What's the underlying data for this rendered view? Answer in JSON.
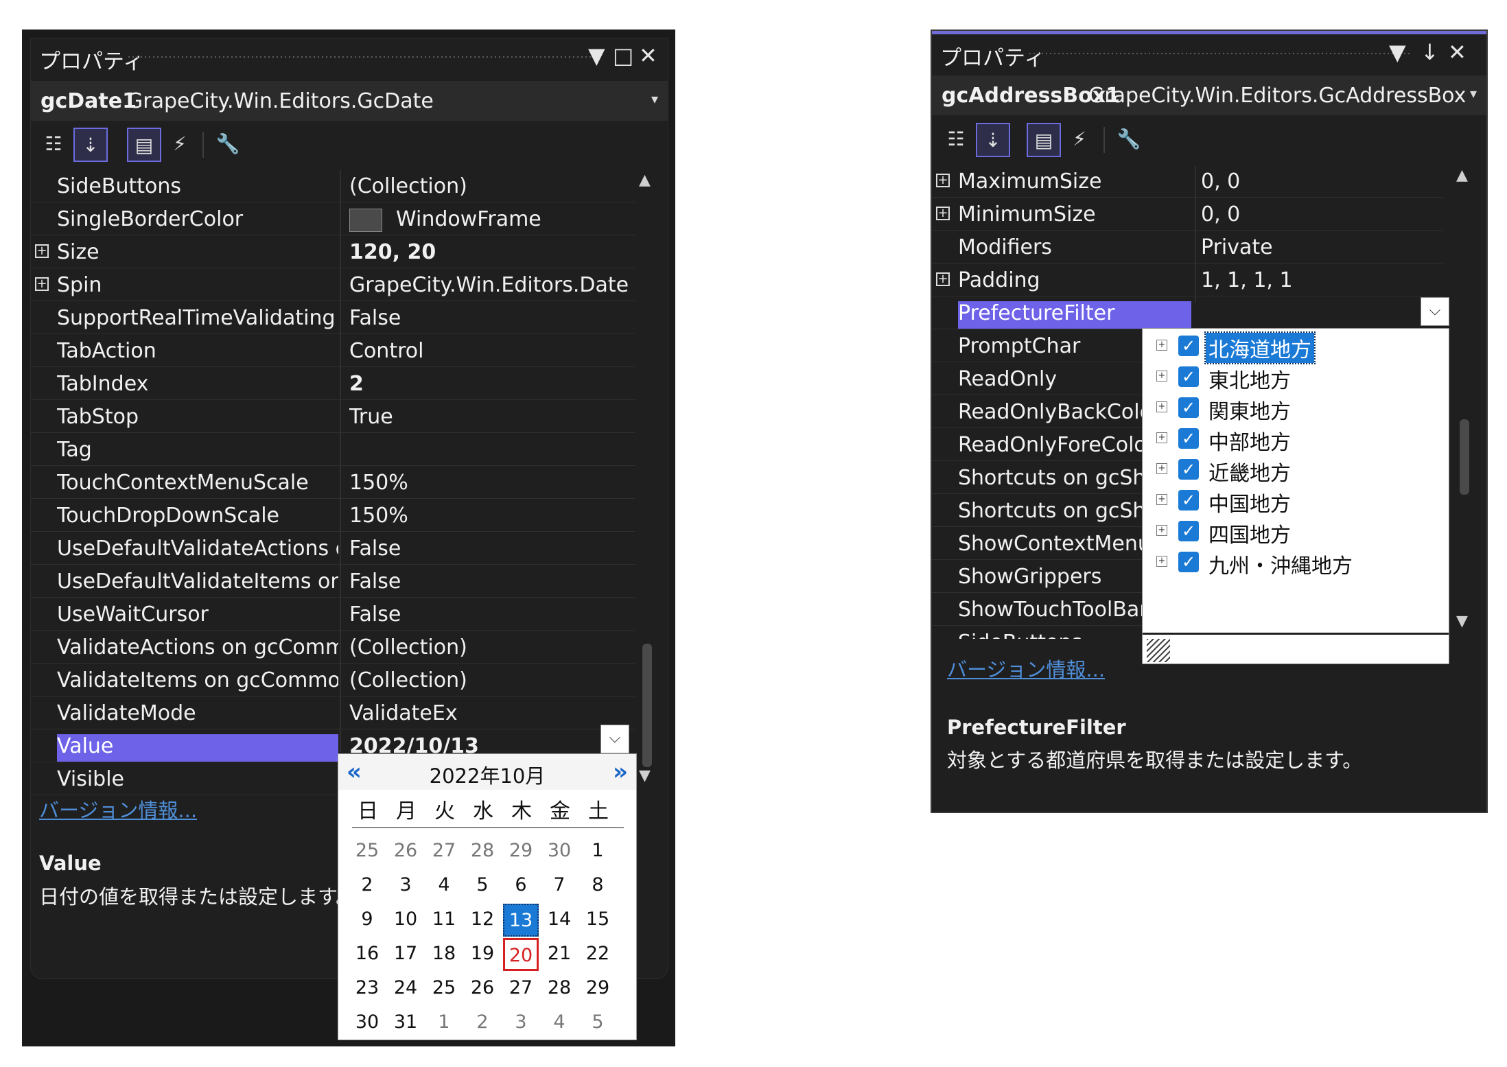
{
  "panel1": {
    "title": "プロパティ",
    "controls": [
      "▼",
      "□",
      "✕"
    ],
    "object_name": "gcDate1",
    "object_class": "GrapeCity.Win.Editors.GcDate",
    "rows": [
      {
        "name": "SideButtons",
        "value": "(Collection)",
        "expand": false,
        "bold": false
      },
      {
        "name": "SingleBorderColor",
        "value": "WindowFrame",
        "expand": false,
        "bold": false,
        "swatch": "#4a4a4a"
      },
      {
        "name": "Size",
        "value": "120, 20",
        "expand": true,
        "bold": true
      },
      {
        "name": "Spin",
        "value": "GrapeCity.Win.Editors.DateSpin",
        "expand": true,
        "bold": false
      },
      {
        "name": "SupportRealTimeValidating on",
        "value": "False",
        "expand": false,
        "bold": false
      },
      {
        "name": "TabAction",
        "value": "Control",
        "expand": false,
        "bold": false
      },
      {
        "name": "TabIndex",
        "value": "2",
        "expand": false,
        "bold": true
      },
      {
        "name": "TabStop",
        "value": "True",
        "expand": false,
        "bold": false
      },
      {
        "name": "Tag",
        "value": "",
        "expand": false,
        "bold": false
      },
      {
        "name": "TouchContextMenuScale",
        "value": "150%",
        "expand": false,
        "bold": false
      },
      {
        "name": "TouchDropDownScale",
        "value": "150%",
        "expand": false,
        "bold": false
      },
      {
        "name": "UseDefaultValidateActions on",
        "value": "False",
        "expand": false,
        "bold": false
      },
      {
        "name": "UseDefaultValidateItems on gc",
        "value": "False",
        "expand": false,
        "bold": false
      },
      {
        "name": "UseWaitCursor",
        "value": "False",
        "expand": false,
        "bold": false
      },
      {
        "name": "ValidateActions on gcCommor",
        "value": "(Collection)",
        "expand": false,
        "bold": false
      },
      {
        "name": "ValidateItems on gcCommonV",
        "value": "(Collection)",
        "expand": false,
        "bold": false
      },
      {
        "name": "ValidateMode",
        "value": "ValidateEx",
        "expand": false,
        "bold": false
      },
      {
        "name": "Value",
        "value": "2022/10/13",
        "expand": false,
        "bold": true,
        "selected": true
      },
      {
        "name": "Visible",
        "value": "",
        "expand": false,
        "bold": false
      }
    ],
    "version_link": "バージョン情報...",
    "desc_title": "Value",
    "desc_text": "日付の値を取得または設定します。"
  },
  "calendar": {
    "prev": "«",
    "next": "»",
    "month_label": "2022年10月",
    "weekdays": [
      "日",
      "月",
      "火",
      "水",
      "木",
      "金",
      "土"
    ],
    "weeks": [
      [
        "25",
        "26",
        "27",
        "28",
        "29",
        "30",
        "1"
      ],
      [
        "2",
        "3",
        "4",
        "5",
        "6",
        "7",
        "8"
      ],
      [
        "9",
        "10",
        "11",
        "12",
        "13",
        "14",
        "15"
      ],
      [
        "16",
        "17",
        "18",
        "19",
        "20",
        "21",
        "22"
      ],
      [
        "23",
        "24",
        "25",
        "26",
        "27",
        "28",
        "29"
      ],
      [
        "30",
        "31",
        "1",
        "2",
        "3",
        "4",
        "5"
      ]
    ],
    "selected_day": "13",
    "today_day": "20"
  },
  "panel2": {
    "title": "プロパティ",
    "controls": [
      "▼",
      "↓",
      "✕"
    ],
    "object_name": "gcAddressBox1",
    "object_class": "GrapeCity.Win.Editors.GcAddressBox",
    "rows": [
      {
        "name": "MaximumSize",
        "value": "0, 0",
        "expand": true
      },
      {
        "name": "MinimumSize",
        "value": "0, 0",
        "expand": true
      },
      {
        "name": "Modifiers",
        "value": "Private",
        "expand": false
      },
      {
        "name": "Padding",
        "value": "1, 1, 1, 1",
        "expand": true
      },
      {
        "name": "PrefectureFilter",
        "value": "",
        "expand": false,
        "selected": true
      },
      {
        "name": "PromptChar",
        "value": "",
        "expand": false
      },
      {
        "name": "ReadOnly",
        "value": "",
        "expand": false
      },
      {
        "name": "ReadOnlyBackColo",
        "value": "",
        "expand": false
      },
      {
        "name": "ReadOnlyForeColo",
        "value": "",
        "expand": false
      },
      {
        "name": "Shortcuts on gcShc",
        "value": "",
        "expand": false
      },
      {
        "name": "Shortcuts on gcShc",
        "value": "",
        "expand": false
      },
      {
        "name": "ShowContextMenu",
        "value": "",
        "expand": false
      },
      {
        "name": "ShowGrippers",
        "value": "",
        "expand": false
      },
      {
        "name": "ShowTouchToolBar",
        "value": "",
        "expand": false
      },
      {
        "name": "SideButtons",
        "value": "",
        "expand": false
      }
    ],
    "version_link": "バージョン情報...",
    "desc_title": "PrefectureFilter",
    "desc_text": "対象とする都道府県を取得または設定します。"
  },
  "prefectures": {
    "items": [
      {
        "label": "北海道地方",
        "checked": true
      },
      {
        "label": "東北地方",
        "checked": true
      },
      {
        "label": "関東地方",
        "checked": true
      },
      {
        "label": "中部地方",
        "checked": true
      },
      {
        "label": "近畿地方",
        "checked": true
      },
      {
        "label": "中国地方",
        "checked": true
      },
      {
        "label": "四国地方",
        "checked": true
      },
      {
        "label": "九州・沖縄地方",
        "checked": true
      }
    ]
  },
  "colors": {
    "selection": "#6d62e8",
    "calendar_selected": "#1a7ad6",
    "calendar_today": "#d42020",
    "link": "#4f8ed8"
  }
}
